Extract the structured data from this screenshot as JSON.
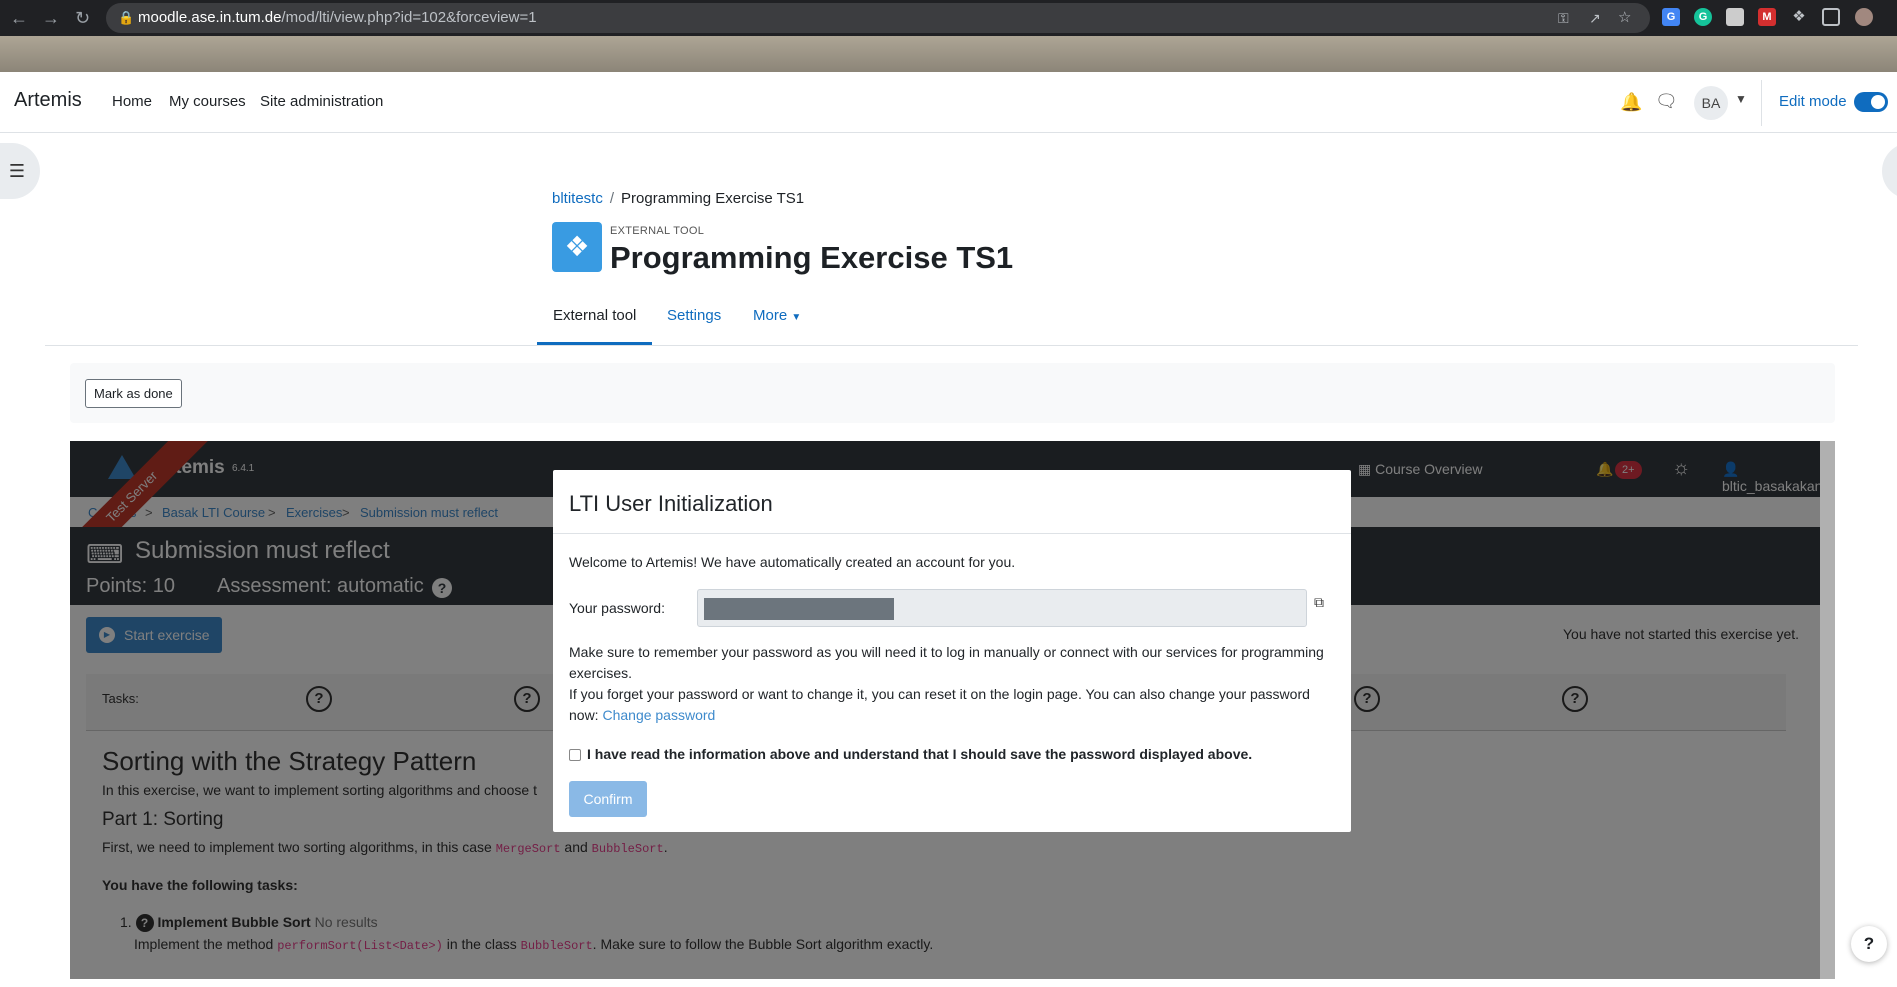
{
  "browser": {
    "url_host": "moodle.ase.in.tum.de",
    "url_path": "/mod/lti/view.php?id=102&forceview=1"
  },
  "moodle": {
    "brand": "Artemis",
    "nav": [
      "Home",
      "My courses",
      "Site administration"
    ],
    "avatar_initials": "BA",
    "edit_mode_label": "Edit mode",
    "breadcrumb": {
      "course": "bltitestc",
      "sep": "/",
      "current": "Programming Exercise TS1"
    },
    "activity_type": "EXTERNAL TOOL",
    "page_title": "Programming Exercise TS1",
    "tabs": [
      "External tool",
      "Settings",
      "More"
    ],
    "mark_done_label": "Mark as done"
  },
  "artemis": {
    "brand": "Artemis",
    "version": "6.4.1",
    "ribbon": "Test Server",
    "nav": {
      "course_overview": "Course Overview",
      "notif_badge": "2+",
      "user": "bltic_basakakan"
    },
    "breadcrumb": [
      "Courses",
      "Basak LTI Course",
      "Exercises",
      "Submission must reflect"
    ],
    "breadcrumb_sep": ">",
    "exercise_title": "Submission must reflect",
    "points": "Points: 10",
    "assessment": "Assessment: automatic",
    "help_glyph": "?",
    "start_label": "Start exercise",
    "not_started": "You have not started this exercise yet.",
    "tasks_label": "Tasks:",
    "content": {
      "h2": "Sorting with the Strategy Pattern",
      "intro": "In this exercise, we want to implement sorting algorithms and choose t",
      "part1": "Part 1: Sorting",
      "part1_text_a": "First, we need to implement two sorting algorithms, in this case ",
      "part1_code1": "MergeSort",
      "part1_and": " and ",
      "part1_code2": "BubbleSort",
      "part1_end": ".",
      "tasks_heading": "You have the following tasks:",
      "task1_num": "1.",
      "task1_title": "Implement Bubble Sort",
      "task1_result": " No results",
      "task1_a": "Implement the method ",
      "task1_code1": "performSort(List<Date>)",
      "task1_b": " in the class ",
      "task1_code2": "BubbleSort",
      "task1_c": ". Make sure to follow the Bubble Sort algorithm exactly."
    }
  },
  "modal": {
    "title": "LTI User Initialization",
    "welcome": "Welcome to Artemis! We have automatically created an account for you.",
    "password_label": "Your password:",
    "remember": "Make sure to remember your password as you will need it to log in manually or connect with our services for programming exercises.",
    "forget": "If you forget your password or want to change it, you can reset it on the login page. You can also change your password now: ",
    "change_password_link": "Change password",
    "ack_label": "I have read the information above and understand that I should save the password displayed above.",
    "confirm_label": "Confirm"
  },
  "help_fab": "?",
  "icons": [
    "back-icon",
    "forward-icon",
    "reload-icon",
    "lock-icon",
    "key-icon",
    "share-icon",
    "star-icon",
    "puzzle-icon",
    "bell-icon",
    "chat-icon",
    "copy-icon",
    "keyboard-icon",
    "play-icon",
    "sun-icon",
    "user-icon",
    "grid-icon"
  ]
}
